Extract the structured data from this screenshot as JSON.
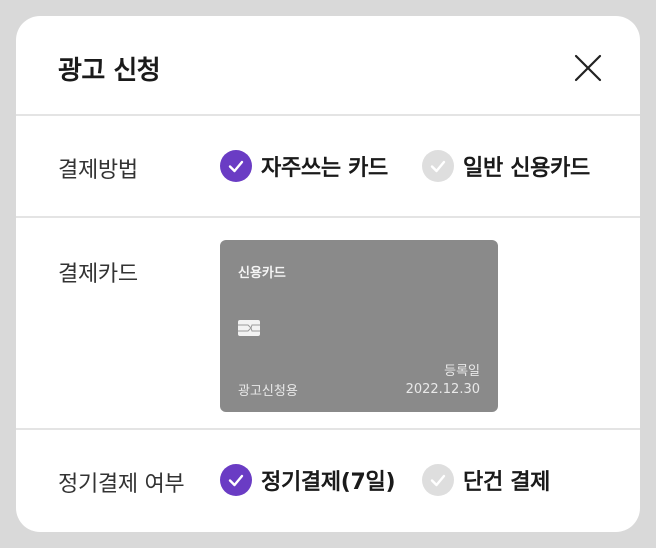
{
  "modal": {
    "title": "광고 신청",
    "close_icon": "close-icon"
  },
  "payment_method": {
    "label": "결제방법",
    "options": [
      {
        "label": "자주쓰는 카드",
        "selected": true
      },
      {
        "label": "일반 신용카드",
        "selected": false
      }
    ]
  },
  "payment_card": {
    "label": "결제카드",
    "card": {
      "name": "신용카드",
      "owner": "광고신청용",
      "registered_label": "등록일",
      "registered_date": "2022.12.30",
      "chip_icon": "card-chip-icon"
    }
  },
  "recurring_payment": {
    "label": "정기결제 여부",
    "options": [
      {
        "label": "정기결제(7일)",
        "selected": true
      },
      {
        "label": "단건 결제",
        "selected": false
      }
    ]
  },
  "colors": {
    "accent": "#6a3cc4",
    "unchecked": "#dedede",
    "card_background": "#8a8a8a",
    "backdrop": "#d9d9d9"
  }
}
